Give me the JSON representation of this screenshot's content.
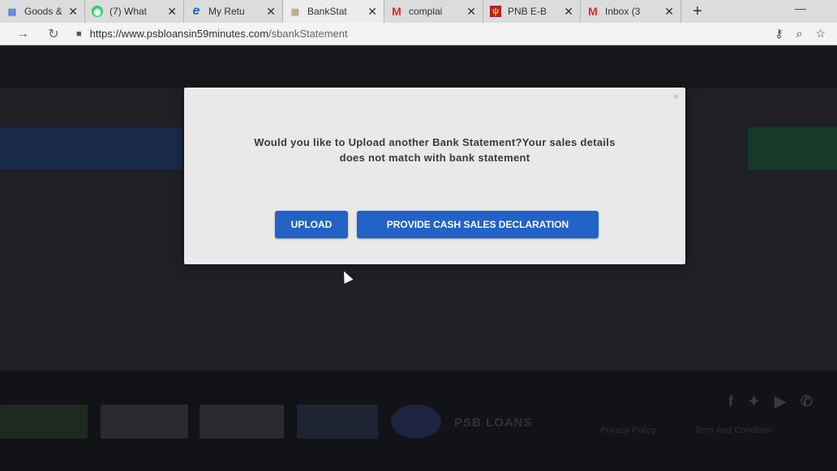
{
  "browser": {
    "tabs": [
      {
        "label": "Goods &",
        "favicon": "doc",
        "active": false
      },
      {
        "label": "(7) What",
        "favicon": "whatsapp",
        "active": false
      },
      {
        "label": "My Retu",
        "favicon": "ie",
        "active": false
      },
      {
        "label": "BankStat",
        "favicon": "page",
        "active": true
      },
      {
        "label": "complai",
        "favicon": "gmail",
        "active": false
      },
      {
        "label": "PNB E-B",
        "favicon": "pnb",
        "active": false
      },
      {
        "label": "Inbox (3",
        "favicon": "gmail",
        "active": false
      }
    ],
    "url_host": "https://www.psbloansin59minutes.com",
    "url_path": "/sbankStatement"
  },
  "modal": {
    "message_line1": "Would you like to Upload another Bank Statement?Your sales details",
    "message_line2": "does not match with bank statement",
    "close_label": "×",
    "upload_label": "UPLOAD",
    "declaration_label": "PROVIDE CASH SALES DECLARATION"
  },
  "footer": {
    "brand": "PSB LOANS",
    "privacy": "Privacy Policy",
    "terms": "Term And Condition"
  },
  "colors": {
    "button_blue": "#2263c7",
    "modal_bg": "#e9e9e9",
    "page_bg": "#1e2026"
  }
}
